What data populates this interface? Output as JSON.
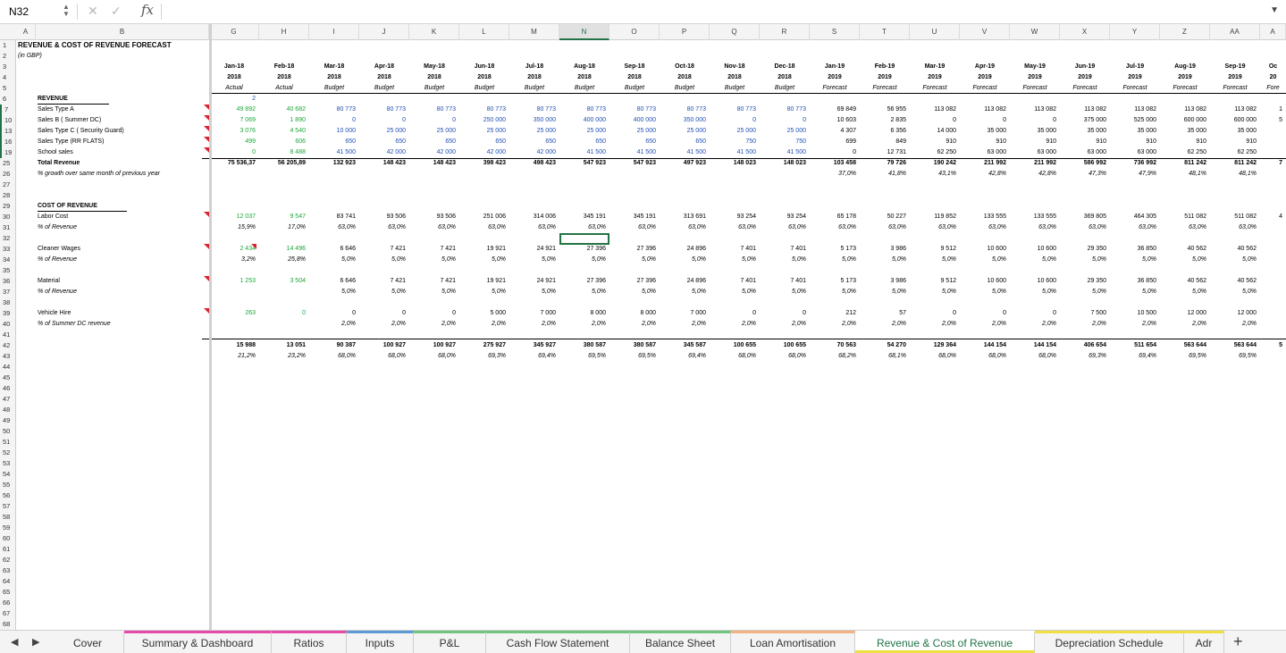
{
  "formula_bar": {
    "cell_ref": "N32",
    "formula": ""
  },
  "active_column": "N",
  "columns": [
    "A",
    "B",
    "G",
    "H",
    "I",
    "J",
    "K",
    "L",
    "M",
    "N",
    "O",
    "P",
    "Q",
    "R",
    "S",
    "T",
    "U",
    "V",
    "W",
    "X",
    "Y",
    "Z",
    "AA",
    "A"
  ],
  "rows": [
    "1",
    "2",
    "3",
    "4",
    "5",
    "6",
    "7",
    "10",
    "13",
    "16",
    "19",
    "25",
    "26",
    "27",
    "28",
    "29",
    "30",
    "31",
    "32",
    "33",
    "34",
    "35",
    "36",
    "37",
    "38",
    "39",
    "40",
    "41",
    "42",
    "43",
    "44",
    "45",
    "46",
    "47",
    "48",
    "49",
    "50",
    "51",
    "52",
    "53",
    "54",
    "55",
    "56",
    "57",
    "58",
    "59",
    "60",
    "61",
    "62",
    "63",
    "64",
    "65",
    "66",
    "67",
    "68"
  ],
  "grouped_rows": [
    "7",
    "10",
    "13",
    "16",
    "19"
  ],
  "title": "REVENUE & COST OF REVENUE FORECAST",
  "subtitle": "(in GBP)",
  "periods": [
    {
      "m": "Jan-18",
      "y": "2018",
      "t": "Actual"
    },
    {
      "m": "Feb-18",
      "y": "2018",
      "t": "Actual"
    },
    {
      "m": "Mar-18",
      "y": "2018",
      "t": "Budget"
    },
    {
      "m": "Apr-18",
      "y": "2018",
      "t": "Budget"
    },
    {
      "m": "May-18",
      "y": "2018",
      "t": "Budget"
    },
    {
      "m": "Jun-18",
      "y": "2018",
      "t": "Budget"
    },
    {
      "m": "Jul-18",
      "y": "2018",
      "t": "Budget"
    },
    {
      "m": "Aug-18",
      "y": "2018",
      "t": "Budget"
    },
    {
      "m": "Sep-18",
      "y": "2018",
      "t": "Budget"
    },
    {
      "m": "Oct-18",
      "y": "2018",
      "t": "Budget"
    },
    {
      "m": "Nov-18",
      "y": "2018",
      "t": "Budget"
    },
    {
      "m": "Dec-18",
      "y": "2018",
      "t": "Budget"
    },
    {
      "m": "Jan-19",
      "y": "2019",
      "t": "Forecast"
    },
    {
      "m": "Feb-19",
      "y": "2019",
      "t": "Forecast"
    },
    {
      "m": "Mar-19",
      "y": "2019",
      "t": "Forecast"
    },
    {
      "m": "Apr-19",
      "y": "2019",
      "t": "Forecast"
    },
    {
      "m": "May-19",
      "y": "2019",
      "t": "Forecast"
    },
    {
      "m": "Jun-19",
      "y": "2019",
      "t": "Forecast"
    },
    {
      "m": "Jul-19",
      "y": "2019",
      "t": "Forecast"
    },
    {
      "m": "Aug-19",
      "y": "2019",
      "t": "Forecast"
    },
    {
      "m": "Sep-19",
      "y": "2019",
      "t": "Forecast"
    },
    {
      "m": "Oc",
      "y": "20",
      "t": "Fore"
    }
  ],
  "sections": [
    {
      "name": "REVENUE",
      "marker": "2",
      "lines": [
        {
          "label": "Sales Type A",
          "style": "normal",
          "values": [
            "49 892",
            "40 682",
            "80 773",
            "80 773",
            "80 773",
            "80 773",
            "80 773",
            "80 773",
            "80 773",
            "80 773",
            "80 773",
            "80 773",
            "69 849",
            "56 955",
            "113 082",
            "113 082",
            "113 082",
            "113 082",
            "113 082",
            "113 082",
            "113 082",
            "1"
          ]
        },
        {
          "label": "Sales B ( Summer DC)",
          "style": "normal",
          "values": [
            "7 069",
            "1 890",
            "0",
            "0",
            "0",
            "250 000",
            "350 000",
            "400 000",
            "400 000",
            "350 000",
            "0",
            "0",
            "10 603",
            "2 835",
            "0",
            "0",
            "0",
            "375 000",
            "525 000",
            "600 000",
            "600 000",
            "5"
          ]
        },
        {
          "label": "Sales Type C ( Security Guard)",
          "style": "normal",
          "values": [
            "3 076",
            "4 540",
            "10 000",
            "25 000",
            "25 000",
            "25 000",
            "25 000",
            "25 000",
            "25 000",
            "25 000",
            "25 000",
            "25 000",
            "4 307",
            "6 356",
            "14 000",
            "35 000",
            "35 000",
            "35 000",
            "35 000",
            "35 000",
            "35 000",
            ""
          ]
        },
        {
          "label": "Sales Type (RR FLATS)",
          "style": "normal",
          "values": [
            "499",
            "606",
            "650",
            "650",
            "650",
            "650",
            "650",
            "650",
            "650",
            "650",
            "750",
            "750",
            "699",
            "849",
            "910",
            "910",
            "910",
            "910",
            "910",
            "910",
            "910",
            ""
          ]
        },
        {
          "label": "School sales",
          "style": "normal",
          "values": [
            "0",
            "8 488",
            "41 500",
            "42 000",
            "42 000",
            "42 000",
            "42 000",
            "41 500",
            "41 500",
            "41 500",
            "41 500",
            "41 500",
            "0",
            "12 731",
            "62 250",
            "63 000",
            "63 000",
            "63 000",
            "63 000",
            "62 250",
            "62 250",
            ""
          ]
        },
        {
          "label": "Total Revenue",
          "style": "total",
          "values": [
            "75 536,37",
            "56 205,89",
            "132 923",
            "148 423",
            "148 423",
            "398 423",
            "498 423",
            "547 923",
            "547 923",
            "497 923",
            "148 023",
            "148 023",
            "103 458",
            "79 726",
            "190 242",
            "211 992",
            "211 992",
            "586 992",
            "736 992",
            "811 242",
            "811 242",
            "7"
          ]
        },
        {
          "label": "% growth over same month of previous year",
          "style": "pct",
          "values": [
            "",
            "",
            "",
            "",
            "",
            "",
            "",
            "",
            "",
            "",
            "",
            "",
            "37,0%",
            "41,8%",
            "43,1%",
            "42,8%",
            "42,8%",
            "47,3%",
            "47,9%",
            "48,1%",
            "48,1%",
            ""
          ]
        }
      ]
    },
    {
      "name": "COST OF REVENUE",
      "groups": [
        {
          "label": "Labor Cost",
          "sub": "% of Revenue",
          "values": [
            "12 037",
            "9 547",
            "83 741",
            "93 506",
            "93 506",
            "251 006",
            "314 006",
            "345 191",
            "345 191",
            "313 691",
            "93 254",
            "93 254",
            "65 178",
            "50 227",
            "119 852",
            "133 555",
            "133 555",
            "369 805",
            "464 305",
            "511 082",
            "511 082",
            "4"
          ],
          "pcts": [
            "15,9%",
            "17,0%",
            "63,0%",
            "63,0%",
            "63,0%",
            "63,0%",
            "63,0%",
            "63,0%",
            "63,0%",
            "63,0%",
            "63,0%",
            "63,0%",
            "63,0%",
            "63,0%",
            "63,0%",
            "63,0%",
            "63,0%",
            "63,0%",
            "63,0%",
            "63,0%",
            "63,0%",
            ""
          ]
        },
        {
          "label": "Cleaner Wages",
          "sub": "% of Revenue",
          "values": [
            "2 434",
            "14 496",
            "6 646",
            "7 421",
            "7 421",
            "19 921",
            "24 921",
            "27 396",
            "27 396",
            "24 896",
            "7 401",
            "7 401",
            "5 173",
            "3 986",
            "9 512",
            "10 600",
            "10 600",
            "29 350",
            "36 850",
            "40 562",
            "40 562",
            ""
          ],
          "pcts": [
            "3,2%",
            "25,8%",
            "5,0%",
            "5,0%",
            "5,0%",
            "5,0%",
            "5,0%",
            "5,0%",
            "5,0%",
            "5,0%",
            "5,0%",
            "5,0%",
            "5,0%",
            "5,0%",
            "5,0%",
            "5,0%",
            "5,0%",
            "5,0%",
            "5,0%",
            "5,0%",
            "5,0%",
            ""
          ]
        },
        {
          "label": "Material",
          "sub": "% of Revenue",
          "values": [
            "1 253",
            "3 504",
            "6 646",
            "7 421",
            "7 421",
            "19 921",
            "24 921",
            "27 396",
            "27 396",
            "24 896",
            "7 401",
            "7 401",
            "5 173",
            "3 986",
            "9 512",
            "10 600",
            "10 600",
            "29 350",
            "36 850",
            "40 562",
            "40 562",
            ""
          ],
          "pcts": [
            "",
            "",
            "5,0%",
            "5,0%",
            "5,0%",
            "5,0%",
            "5,0%",
            "5,0%",
            "5,0%",
            "5,0%",
            "5,0%",
            "5,0%",
            "5,0%",
            "5,0%",
            "5,0%",
            "5,0%",
            "5,0%",
            "5,0%",
            "5,0%",
            "5,0%",
            "5,0%",
            ""
          ]
        },
        {
          "label": "Vehicle Hire",
          "sub": "% of Summer DC revenue",
          "values": [
            "263",
            "0",
            "0",
            "0",
            "0",
            "5 000",
            "7 000",
            "8 000",
            "8 000",
            "7 000",
            "0",
            "0",
            "212",
            "57",
            "0",
            "0",
            "0",
            "7 500",
            "10 500",
            "12 000",
            "12 000",
            ""
          ],
          "pcts": [
            "",
            "",
            "2,0%",
            "2,0%",
            "2,0%",
            "2,0%",
            "2,0%",
            "2,0%",
            "2,0%",
            "2,0%",
            "2,0%",
            "2,0%",
            "2,0%",
            "2,0%",
            "2,0%",
            "2,0%",
            "2,0%",
            "2,0%",
            "2,0%",
            "2,0%",
            "2,0%",
            ""
          ]
        }
      ],
      "total_values": [
        "15 988",
        "13 051",
        "90 387",
        "100 927",
        "100 927",
        "275 927",
        "345 927",
        "380 587",
        "380 587",
        "345 587",
        "100 655",
        "100 655",
        "70 563",
        "54 270",
        "129 364",
        "144 154",
        "144 154",
        "406 654",
        "511 654",
        "563 644",
        "563 644",
        "5"
      ],
      "total_pcts": [
        "21,2%",
        "23,2%",
        "68,0%",
        "68,0%",
        "68,0%",
        "69,3%",
        "69,4%",
        "69,5%",
        "69,5%",
        "69,4%",
        "68,0%",
        "68,0%",
        "68,2%",
        "68,1%",
        "68,0%",
        "68,0%",
        "68,0%",
        "69,3%",
        "69,4%",
        "69,5%",
        "69,5%",
        ""
      ]
    }
  ],
  "sheet_tabs": [
    {
      "label": "Cover",
      "color": ""
    },
    {
      "label": "Summary & Dashboard",
      "color": "#e64aa8"
    },
    {
      "label": "Ratios",
      "color": "#e64aa8"
    },
    {
      "label": "Inputs",
      "color": "#5b9bd5"
    },
    {
      "label": "P&L",
      "color": "#70c47e"
    },
    {
      "label": "Cash Flow Statement",
      "color": "#70c47e"
    },
    {
      "label": "Balance Sheet",
      "color": "#70c47e"
    },
    {
      "label": "Loan Amortisation",
      "color": "#f4b183"
    },
    {
      "label": "Revenue & Cost of Revenue",
      "color": "#f0df40",
      "active": true
    },
    {
      "label": "Depreciation Schedule",
      "color": "#f0df40"
    },
    {
      "label": "Adr",
      "color": "#f0df40"
    }
  ],
  "colors": {
    "accent": "#217346",
    "input_green": "#1aa836",
    "input_blue": "#1f4fb4",
    "note_red": "#d9232e"
  }
}
